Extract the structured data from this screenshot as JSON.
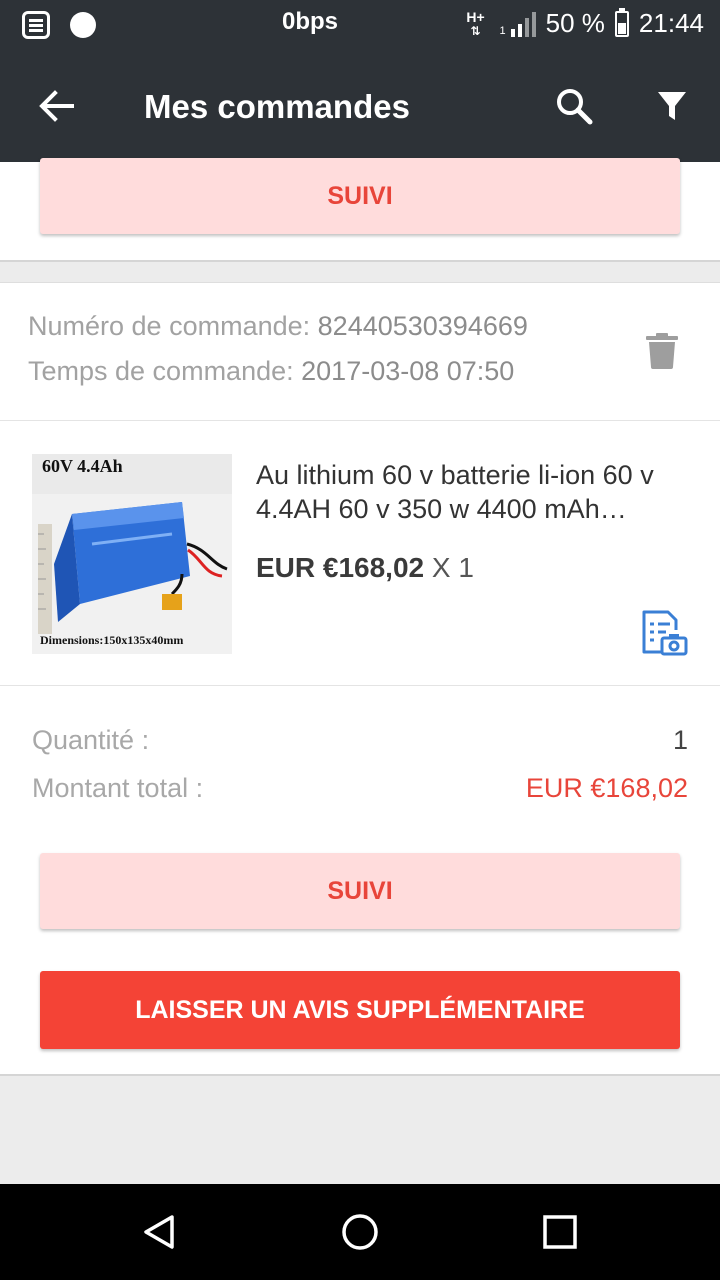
{
  "status_bar": {
    "speed": "0bps",
    "network": "H+",
    "sim_slot": "1",
    "battery": "50 %",
    "battery_level": 0.5,
    "time": "21:44"
  },
  "toolbar": {
    "title": "Mes commandes",
    "back_icon": "arrow-left-icon",
    "search_icon": "search-icon",
    "filter_icon": "filter-icon"
  },
  "previous_order": {
    "track_button": "SUIVI"
  },
  "order": {
    "number_label": "Numéro de commande:",
    "number_value": "82440530394669",
    "time_label": "Temps de commande:",
    "time_value": "2017-03-08 07:50",
    "delete_icon": "trash-icon",
    "product": {
      "title": "Au lithium 60 v batterie li-ion 60 v 4.4AH 60 v 350 w 4400 mAh…",
      "price": "EUR €168,02",
      "quantity_text": "X 1",
      "image_caption_top": "60V 4.4Ah",
      "image_caption_bottom": "Dimensions:150x135x40mm",
      "snapshot_icon": "document-camera-icon"
    },
    "quantity_label": "Quantité :",
    "quantity_value": "1",
    "total_label": "Montant total :",
    "total_value": "EUR €168,02",
    "track_button": "SUIVI",
    "review_button": "LAISSER UN AVIS SUPPLÉMENTAIRE"
  },
  "nav_bar": {
    "back_icon": "triangle-back-icon",
    "home_icon": "circle-home-icon",
    "recents_icon": "square-recents-icon"
  },
  "colors": {
    "toolbar_bg": "#2d3237",
    "accent_red": "#f44336",
    "light_red": "#ffdcdc",
    "link_blue": "#3a7fd5"
  }
}
